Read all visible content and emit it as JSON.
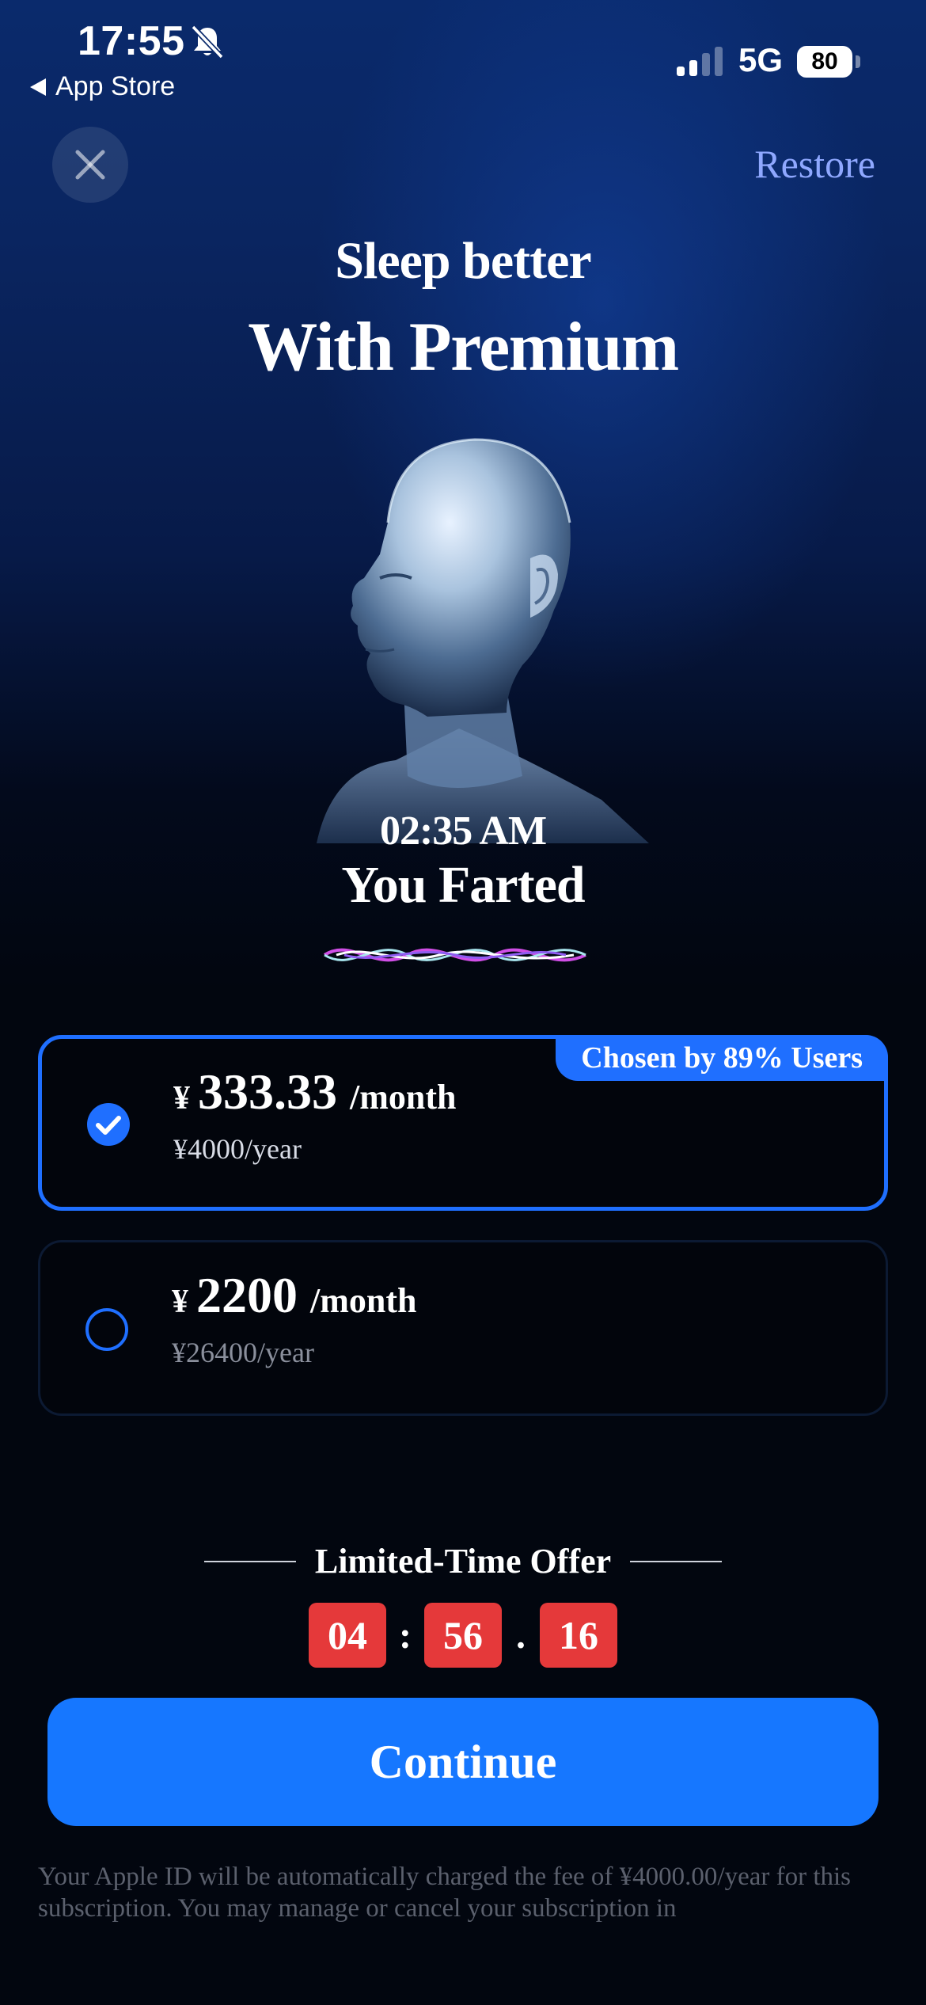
{
  "status_bar": {
    "time": "17:55",
    "back_app": "App Store",
    "network": "5G",
    "battery": "80",
    "icons": [
      "bell-slash-icon",
      "signal-icon",
      "battery-icon"
    ]
  },
  "header": {
    "close_icon": "close-icon",
    "restore_label": "Restore"
  },
  "hero": {
    "title_line1": "Sleep better",
    "title_line2": "With Premium",
    "time": "02:35 AM",
    "event": "You Farted"
  },
  "plans": [
    {
      "selected": true,
      "badge": "Chosen by 89% Users",
      "currency": "¥",
      "price": "333.33",
      "period": "/month",
      "yearly": "¥4000/year"
    },
    {
      "selected": false,
      "currency": "¥",
      "price": "2200",
      "period": "/month",
      "yearly": "¥26400/year"
    }
  ],
  "offer": {
    "label": "Limited-Time Offer",
    "hours": "04",
    "minutes": "56",
    "seconds": "16",
    "sep1": ":",
    "sep2": "."
  },
  "cta": {
    "continue_label": "Continue"
  },
  "legal": {
    "text": "Your Apple ID will be automatically charged the fee of ¥4000.00/year for this subscription. You may manage or cancel your subscription in"
  },
  "colors": {
    "accent": "#1677ff",
    "selected_border": "#1f6fff",
    "restore": "#8fa8ff",
    "countdown": "#e5393a"
  }
}
